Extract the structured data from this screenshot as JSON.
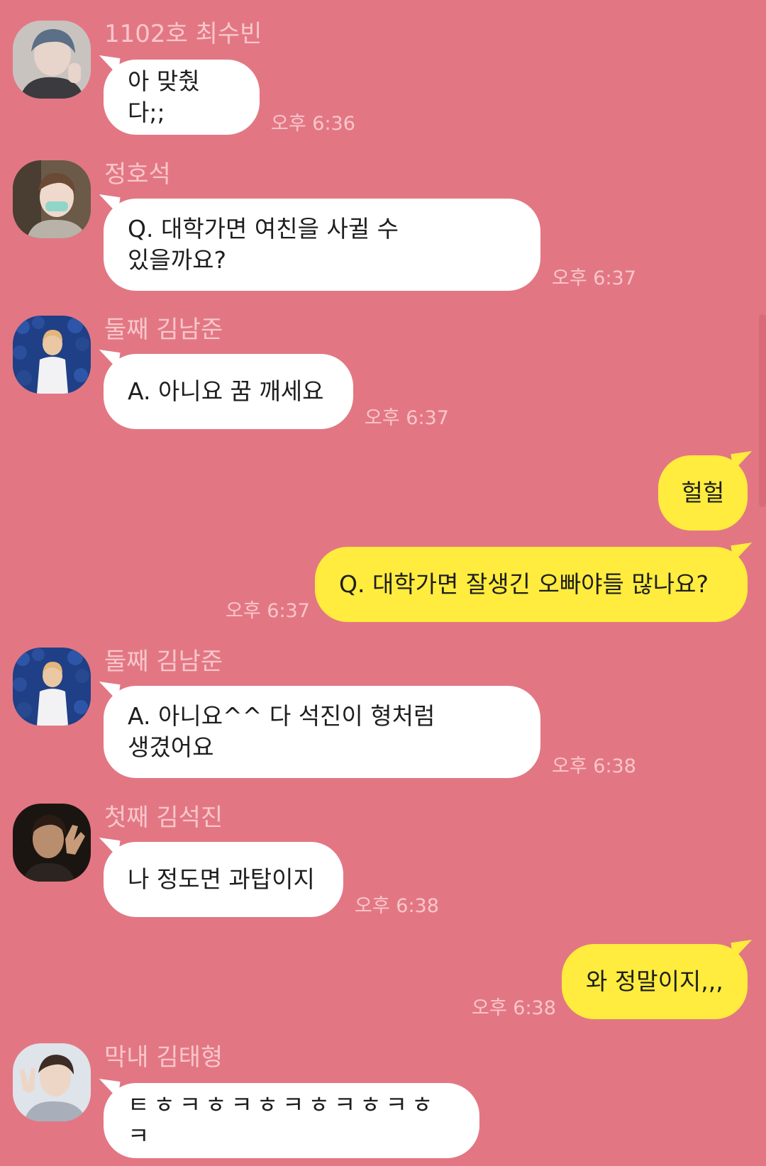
{
  "theme": {
    "background": "#e27783",
    "incoming_bubble": "#ffffff",
    "outgoing_bubble": "#ffec3e",
    "meta_text": "#f8c6cb"
  },
  "messages": [
    {
      "type": "incoming",
      "sender": "1102호 최수빈",
      "avatar": "avatar-photo",
      "text": "아 맞췄다;;",
      "time": "오후 6:36"
    },
    {
      "type": "incoming",
      "sender": "정호석",
      "avatar": "avatar-photo",
      "text": "Q. 대학가면 여친을 사귈 수\n있을까요?",
      "time": "오후 6:37"
    },
    {
      "type": "incoming",
      "sender": "둘째 김남준",
      "avatar": "avatar-photo",
      "text": "A. 아니요 꿈 깨세요",
      "time": "오후 6:37"
    },
    {
      "type": "outgoing",
      "text": "헐헐"
    },
    {
      "type": "outgoing",
      "text": "Q. 대학가면 잘생긴 오빠야들 많나요?",
      "time": "오후 6:37"
    },
    {
      "type": "incoming",
      "sender": "둘째 김남준",
      "avatar": "avatar-photo",
      "text": "A. 아니요^^ 다 석진이 형처럼\n생겼어요",
      "time": "오후 6:38"
    },
    {
      "type": "incoming",
      "sender": "첫째 김석진",
      "avatar": "avatar-photo",
      "text": "나 정도면 과탑이지",
      "time": "오후 6:38"
    },
    {
      "type": "outgoing",
      "text": "와 정말이지,,,",
      "time": "오후 6:38"
    },
    {
      "type": "incoming",
      "sender": "막내 김태형",
      "avatar": "avatar-photo",
      "text": "ㅌㅎㅋㅎㅋㅎㅋㅎㅋㅎㅋㅎㅋ"
    }
  ]
}
